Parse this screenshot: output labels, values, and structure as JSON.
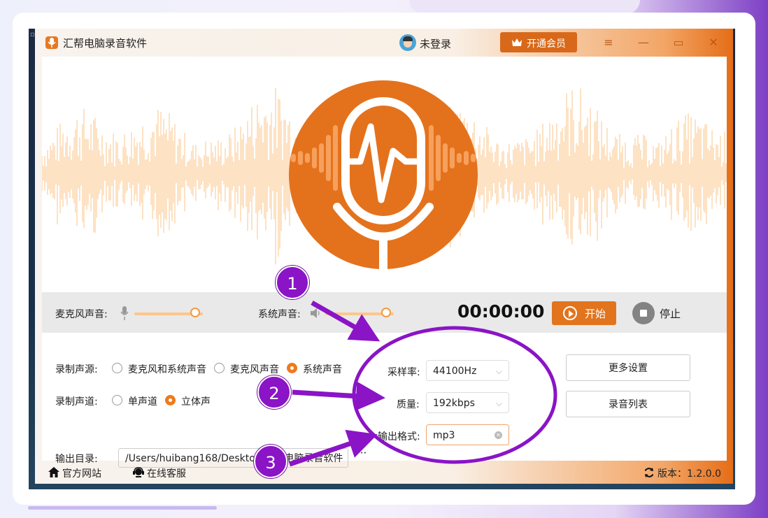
{
  "app": {
    "title": "汇帮电脑录音软件",
    "user_label": "未登录",
    "vip_button": "开通会员"
  },
  "controls": {
    "mic_label": "麦克风声音:",
    "system_label": "系统声音:",
    "mic_level": 0.86,
    "system_level": 0.86,
    "timer": "00:00:00",
    "start_label": "开始",
    "stop_label": "停止"
  },
  "settings": {
    "source_label": "录制声源:",
    "source_options": [
      "麦克风和系统声音",
      "麦克风声音",
      "系统声音"
    ],
    "source_selected": "系统声音",
    "channel_label": "录制声道:",
    "channel_options": [
      "单声道",
      "立体声"
    ],
    "channel_selected": "立体声",
    "output_dir_label": "输出目录:",
    "output_dir_value": "/Users/huibang168/Desktop/汇帮电脑录音软件",
    "browse_label": "···",
    "sample_rate_label": "采样率:",
    "sample_rate_value": "44100Hz",
    "quality_label": "质量:",
    "quality_value": "192kbps",
    "format_label": "输出格式:",
    "format_value": "mp3",
    "more_settings_button": "更多设置",
    "recording_list_button": "录音列表"
  },
  "footer": {
    "website_label": "官方网站",
    "support_label": "在线客服",
    "version_label": "版本：1.2.0.0"
  },
  "annotations": [
    "1",
    "2",
    "3"
  ],
  "colors": {
    "accent": "#e2741d",
    "annotation": "#8a14c6",
    "waveform": "#fcd5ab"
  }
}
